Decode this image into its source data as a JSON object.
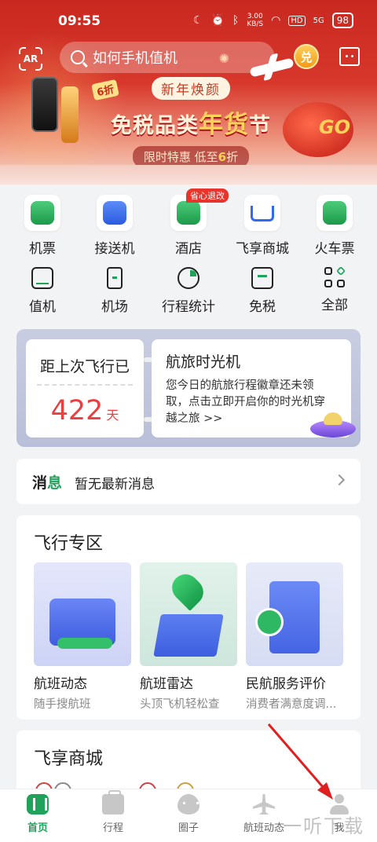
{
  "status_bar": {
    "time": "09:55",
    "net_speed_value": "3.00",
    "net_speed_unit": "KB/S",
    "hd": "HD",
    "signal": "5G",
    "battery": "98"
  },
  "header": {
    "ar_label": "AR",
    "search_placeholder": "如何手机值机",
    "redeem_label": "兑"
  },
  "banner": {
    "tag": "新年焕颜",
    "discount_badge": "6折",
    "main_prefix": "免税品类",
    "main_accent": "年货",
    "main_suffix": "节",
    "sub_prefix": "限时特惠  低至",
    "sub_highlight": "6",
    "sub_suffix": "折",
    "go_text": "GO"
  },
  "quick_grid": {
    "row1": [
      {
        "label": "机票",
        "icon": "airplane-ticket-icon"
      },
      {
        "label": "接送机",
        "icon": "car-icon"
      },
      {
        "label": "酒店",
        "icon": "hotel-icon",
        "badge": "省心退改"
      },
      {
        "label": "飞享商城",
        "icon": "shopping-cart-icon"
      },
      {
        "label": "火车票",
        "icon": "train-icon"
      }
    ],
    "row2": [
      {
        "label": "值机",
        "icon": "checkin-icon"
      },
      {
        "label": "机场",
        "icon": "airport-tower-icon"
      },
      {
        "label": "行程统计",
        "icon": "pie-chart-icon"
      },
      {
        "label": "免税",
        "icon": "store-icon"
      },
      {
        "label": "全部",
        "icon": "grid-icon"
      }
    ]
  },
  "time_machine": {
    "last_flight_label": "距上次飞行已",
    "days_value": "422",
    "days_unit": "天",
    "title": "航旅时光机",
    "description": "您今日的航旅行程徽章还未领取，点击立即开启你的时光机穿越之旅 >>"
  },
  "news": {
    "label_a": "消",
    "label_b": "息",
    "text": "暂无最新消息"
  },
  "flight_zone": {
    "title": "飞行专区",
    "cards": [
      {
        "name": "航班动态",
        "sub": "随手搜航班"
      },
      {
        "name": "航班雷达",
        "sub": "头顶飞机轻松查"
      },
      {
        "name": "民航服务评价",
        "sub": "消费者满意度调..."
      }
    ]
  },
  "mall": {
    "title": "飞享商城"
  },
  "bottom_nav": [
    {
      "label": "首页",
      "active": true
    },
    {
      "label": "行程",
      "active": false
    },
    {
      "label": "圈子",
      "active": false
    },
    {
      "label": "航班动态",
      "active": false
    },
    {
      "label": "我",
      "active": false
    }
  ],
  "watermark": "一听下载",
  "colors": {
    "brand_green": "#1fa35a",
    "banner_red": "#c8281f",
    "days_red": "#e84040",
    "annotation_arrow": "#e02020"
  }
}
